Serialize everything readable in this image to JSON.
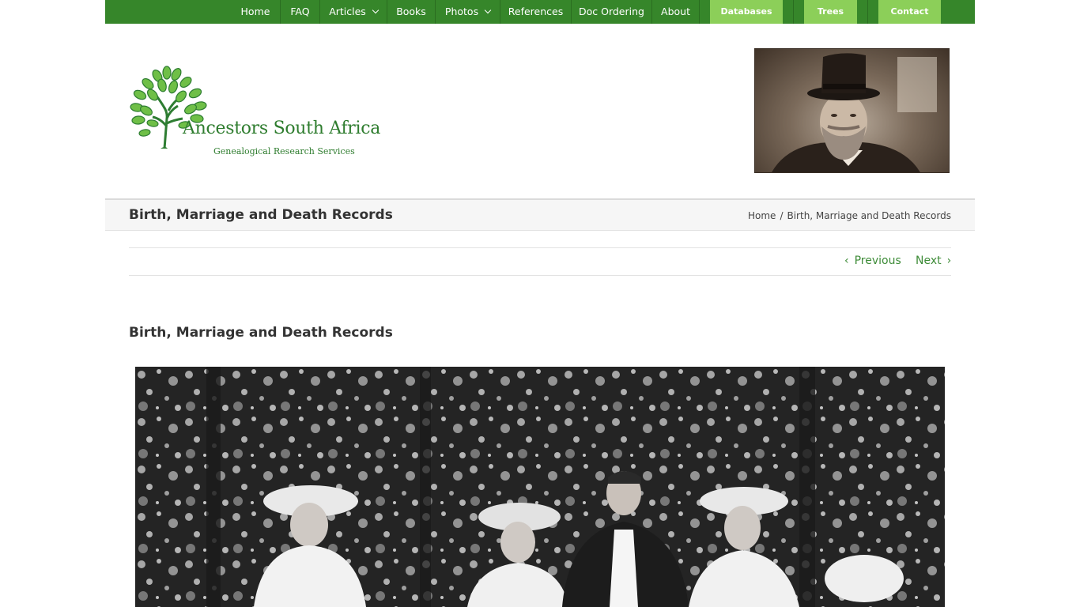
{
  "nav": {
    "items": [
      {
        "label": "Home",
        "dropdown": false
      },
      {
        "label": "FAQ",
        "dropdown": false
      },
      {
        "label": "Articles",
        "dropdown": true
      },
      {
        "label": "Books",
        "dropdown": false
      },
      {
        "label": "Photos",
        "dropdown": true
      },
      {
        "label": "References",
        "dropdown": false
      },
      {
        "label": "Doc Ordering",
        "dropdown": false
      },
      {
        "label": "About",
        "dropdown": false
      }
    ],
    "buttons": [
      "Databases",
      "Trees",
      "Contact"
    ]
  },
  "logo": {
    "title": "Ancestors South Africa",
    "subtitle": "Genealogical Research Services"
  },
  "page_title": "Birth, Marriage and Death Records",
  "breadcrumb": {
    "home": "Home",
    "separator": "/",
    "current": "Birth, Marriage and Death Records"
  },
  "pager": {
    "previous": "Previous",
    "next": "Next"
  },
  "post": {
    "title": "Birth, Marriage and Death Records"
  },
  "colors": {
    "nav_bg": "#36862a",
    "nav_button": "#8ccf59",
    "link": "#3d8b37",
    "logo_green": "#2f7d2f"
  }
}
